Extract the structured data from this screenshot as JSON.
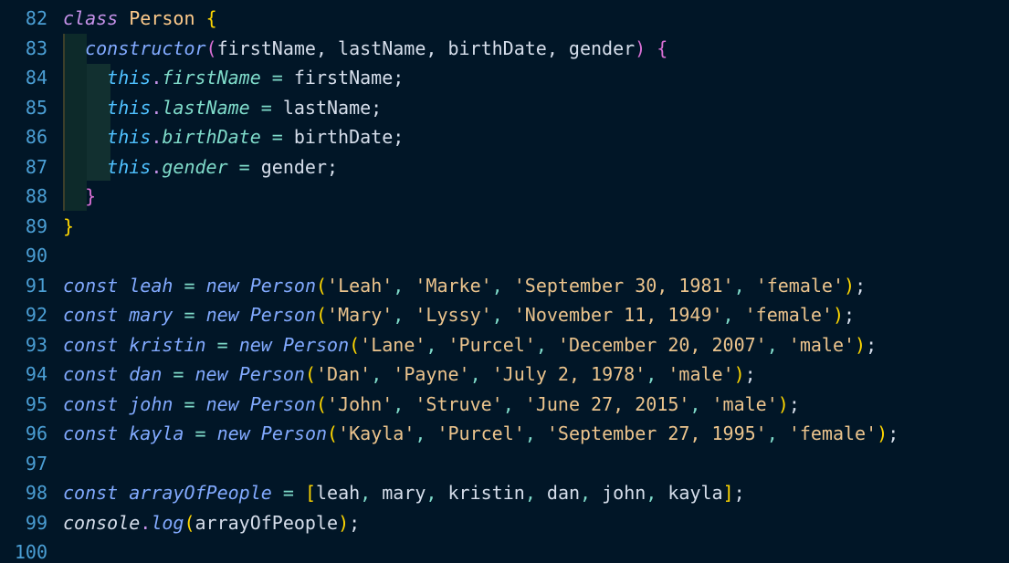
{
  "editor": {
    "lines": [
      {
        "num": "82",
        "tokens": [
          {
            "t": "class",
            "c": "#c792ea",
            "i": true
          },
          {
            "t": " ",
            "c": "#d6deeb"
          },
          {
            "t": "Person",
            "c": "#ffcb8b"
          },
          {
            "t": " ",
            "c": "#d6deeb"
          },
          {
            "t": "{",
            "c": "#ffd700"
          }
        ]
      },
      {
        "num": "83",
        "tokens": [
          {
            "t": "  ",
            "c": "#d6deeb"
          },
          {
            "t": "constructor",
            "c": "#82aaff",
            "i": true
          },
          {
            "t": "(",
            "c": "#da70d6"
          },
          {
            "t": "firstName, lastName, birthDate, gender",
            "c": "#d6deeb"
          },
          {
            "t": ")",
            "c": "#da70d6"
          },
          {
            "t": " ",
            "c": "#d6deeb"
          },
          {
            "t": "{",
            "c": "#da70d6"
          }
        ]
      },
      {
        "num": "84",
        "tokens": [
          {
            "t": "    ",
            "c": "#d6deeb"
          },
          {
            "t": "this",
            "c": "#4fc1ff",
            "i": true
          },
          {
            "t": ".",
            "c": "#c792ea"
          },
          {
            "t": "firstName",
            "c": "#7fdbca",
            "i": true
          },
          {
            "t": " = ",
            "c": "#7fdbca"
          },
          {
            "t": "firstName;",
            "c": "#d6deeb"
          }
        ]
      },
      {
        "num": "85",
        "tokens": [
          {
            "t": "    ",
            "c": "#d6deeb"
          },
          {
            "t": "this",
            "c": "#4fc1ff",
            "i": true
          },
          {
            "t": ".",
            "c": "#c792ea"
          },
          {
            "t": "lastName",
            "c": "#7fdbca",
            "i": true
          },
          {
            "t": " = ",
            "c": "#7fdbca"
          },
          {
            "t": "lastName;",
            "c": "#d6deeb"
          }
        ]
      },
      {
        "num": "86",
        "tokens": [
          {
            "t": "    ",
            "c": "#d6deeb"
          },
          {
            "t": "this",
            "c": "#4fc1ff",
            "i": true
          },
          {
            "t": ".",
            "c": "#c792ea"
          },
          {
            "t": "birthDate",
            "c": "#7fdbca",
            "i": true
          },
          {
            "t": " = ",
            "c": "#7fdbca"
          },
          {
            "t": "birthDate;",
            "c": "#d6deeb"
          }
        ]
      },
      {
        "num": "87",
        "tokens": [
          {
            "t": "    ",
            "c": "#d6deeb"
          },
          {
            "t": "this",
            "c": "#4fc1ff",
            "i": true
          },
          {
            "t": ".",
            "c": "#c792ea"
          },
          {
            "t": "gender",
            "c": "#7fdbca",
            "i": true
          },
          {
            "t": " = ",
            "c": "#7fdbca"
          },
          {
            "t": "gender;",
            "c": "#d6deeb"
          }
        ]
      },
      {
        "num": "88",
        "tokens": [
          {
            "t": "  ",
            "c": "#d6deeb"
          },
          {
            "t": "}",
            "c": "#da70d6"
          }
        ]
      },
      {
        "num": "89",
        "tokens": [
          {
            "t": "}",
            "c": "#ffd700"
          }
        ]
      },
      {
        "num": "90",
        "tokens": []
      },
      {
        "num": "91",
        "tokens": [
          {
            "t": "const",
            "c": "#82aaff",
            "i": true
          },
          {
            "t": " ",
            "c": "#d6deeb"
          },
          {
            "t": "leah",
            "c": "#82aaff",
            "i": true
          },
          {
            "t": " = ",
            "c": "#7fdbca"
          },
          {
            "t": "new",
            "c": "#82aaff",
            "i": true
          },
          {
            "t": " ",
            "c": "#d6deeb"
          },
          {
            "t": "Person",
            "c": "#82aaff",
            "i": true
          },
          {
            "t": "(",
            "c": "#ffd700"
          },
          {
            "t": "'Leah'",
            "c": "#ecc48d"
          },
          {
            "t": ", ",
            "c": "#7fdbca"
          },
          {
            "t": "'Marke'",
            "c": "#ecc48d"
          },
          {
            "t": ", ",
            "c": "#7fdbca"
          },
          {
            "t": "'September 30, 1981'",
            "c": "#ecc48d"
          },
          {
            "t": ", ",
            "c": "#7fdbca"
          },
          {
            "t": "'female'",
            "c": "#ecc48d"
          },
          {
            "t": ")",
            "c": "#ffd700"
          },
          {
            "t": ";",
            "c": "#d6deeb"
          }
        ]
      },
      {
        "num": "92",
        "tokens": [
          {
            "t": "const",
            "c": "#82aaff",
            "i": true
          },
          {
            "t": " ",
            "c": "#d6deeb"
          },
          {
            "t": "mary",
            "c": "#82aaff",
            "i": true
          },
          {
            "t": " = ",
            "c": "#7fdbca"
          },
          {
            "t": "new",
            "c": "#82aaff",
            "i": true
          },
          {
            "t": " ",
            "c": "#d6deeb"
          },
          {
            "t": "Person",
            "c": "#82aaff",
            "i": true
          },
          {
            "t": "(",
            "c": "#ffd700"
          },
          {
            "t": "'Mary'",
            "c": "#ecc48d"
          },
          {
            "t": ", ",
            "c": "#7fdbca"
          },
          {
            "t": "'Lyssy'",
            "c": "#ecc48d"
          },
          {
            "t": ", ",
            "c": "#7fdbca"
          },
          {
            "t": "'November 11, 1949'",
            "c": "#ecc48d"
          },
          {
            "t": ", ",
            "c": "#7fdbca"
          },
          {
            "t": "'female'",
            "c": "#ecc48d"
          },
          {
            "t": ")",
            "c": "#ffd700"
          },
          {
            "t": ";",
            "c": "#d6deeb"
          }
        ]
      },
      {
        "num": "93",
        "tokens": [
          {
            "t": "const",
            "c": "#82aaff",
            "i": true
          },
          {
            "t": " ",
            "c": "#d6deeb"
          },
          {
            "t": "kristin",
            "c": "#82aaff",
            "i": true
          },
          {
            "t": " = ",
            "c": "#7fdbca"
          },
          {
            "t": "new",
            "c": "#82aaff",
            "i": true
          },
          {
            "t": " ",
            "c": "#d6deeb"
          },
          {
            "t": "Person",
            "c": "#82aaff",
            "i": true
          },
          {
            "t": "(",
            "c": "#ffd700"
          },
          {
            "t": "'Lane'",
            "c": "#ecc48d"
          },
          {
            "t": ", ",
            "c": "#7fdbca"
          },
          {
            "t": "'Purcel'",
            "c": "#ecc48d"
          },
          {
            "t": ", ",
            "c": "#7fdbca"
          },
          {
            "t": "'December 20, 2007'",
            "c": "#ecc48d"
          },
          {
            "t": ", ",
            "c": "#7fdbca"
          },
          {
            "t": "'male'",
            "c": "#ecc48d"
          },
          {
            "t": ")",
            "c": "#ffd700"
          },
          {
            "t": ";",
            "c": "#d6deeb"
          }
        ]
      },
      {
        "num": "94",
        "tokens": [
          {
            "t": "const",
            "c": "#82aaff",
            "i": true
          },
          {
            "t": " ",
            "c": "#d6deeb"
          },
          {
            "t": "dan",
            "c": "#82aaff",
            "i": true
          },
          {
            "t": " = ",
            "c": "#7fdbca"
          },
          {
            "t": "new",
            "c": "#82aaff",
            "i": true
          },
          {
            "t": " ",
            "c": "#d6deeb"
          },
          {
            "t": "Person",
            "c": "#82aaff",
            "i": true
          },
          {
            "t": "(",
            "c": "#ffd700"
          },
          {
            "t": "'Dan'",
            "c": "#ecc48d"
          },
          {
            "t": ", ",
            "c": "#7fdbca"
          },
          {
            "t": "'Payne'",
            "c": "#ecc48d"
          },
          {
            "t": ", ",
            "c": "#7fdbca"
          },
          {
            "t": "'July 2, 1978'",
            "c": "#ecc48d"
          },
          {
            "t": ", ",
            "c": "#7fdbca"
          },
          {
            "t": "'male'",
            "c": "#ecc48d"
          },
          {
            "t": ")",
            "c": "#ffd700"
          },
          {
            "t": ";",
            "c": "#d6deeb"
          }
        ]
      },
      {
        "num": "95",
        "tokens": [
          {
            "t": "const",
            "c": "#82aaff",
            "i": true
          },
          {
            "t": " ",
            "c": "#d6deeb"
          },
          {
            "t": "john",
            "c": "#82aaff",
            "i": true
          },
          {
            "t": " = ",
            "c": "#7fdbca"
          },
          {
            "t": "new",
            "c": "#82aaff",
            "i": true
          },
          {
            "t": " ",
            "c": "#d6deeb"
          },
          {
            "t": "Person",
            "c": "#82aaff",
            "i": true
          },
          {
            "t": "(",
            "c": "#ffd700"
          },
          {
            "t": "'John'",
            "c": "#ecc48d"
          },
          {
            "t": ", ",
            "c": "#7fdbca"
          },
          {
            "t": "'Struve'",
            "c": "#ecc48d"
          },
          {
            "t": ", ",
            "c": "#7fdbca"
          },
          {
            "t": "'June 27, 2015'",
            "c": "#ecc48d"
          },
          {
            "t": ", ",
            "c": "#7fdbca"
          },
          {
            "t": "'male'",
            "c": "#ecc48d"
          },
          {
            "t": ")",
            "c": "#ffd700"
          },
          {
            "t": ";",
            "c": "#d6deeb"
          }
        ]
      },
      {
        "num": "96",
        "tokens": [
          {
            "t": "const",
            "c": "#82aaff",
            "i": true
          },
          {
            "t": " ",
            "c": "#d6deeb"
          },
          {
            "t": "kayla",
            "c": "#82aaff",
            "i": true
          },
          {
            "t": " = ",
            "c": "#7fdbca"
          },
          {
            "t": "new",
            "c": "#82aaff",
            "i": true
          },
          {
            "t": " ",
            "c": "#d6deeb"
          },
          {
            "t": "Person",
            "c": "#82aaff",
            "i": true
          },
          {
            "t": "(",
            "c": "#ffd700"
          },
          {
            "t": "'Kayla'",
            "c": "#ecc48d"
          },
          {
            "t": ", ",
            "c": "#7fdbca"
          },
          {
            "t": "'Purcel'",
            "c": "#ecc48d"
          },
          {
            "t": ", ",
            "c": "#7fdbca"
          },
          {
            "t": "'September 27, 1995'",
            "c": "#ecc48d"
          },
          {
            "t": ", ",
            "c": "#7fdbca"
          },
          {
            "t": "'female'",
            "c": "#ecc48d"
          },
          {
            "t": ")",
            "c": "#ffd700"
          },
          {
            "t": ";",
            "c": "#d6deeb"
          }
        ]
      },
      {
        "num": "97",
        "tokens": []
      },
      {
        "num": "98",
        "tokens": [
          {
            "t": "const",
            "c": "#82aaff",
            "i": true
          },
          {
            "t": " ",
            "c": "#d6deeb"
          },
          {
            "t": "arrayOfPeople",
            "c": "#82aaff",
            "i": true
          },
          {
            "t": " = ",
            "c": "#7fdbca"
          },
          {
            "t": "[",
            "c": "#ffd700"
          },
          {
            "t": "leah",
            "c": "#d6deeb"
          },
          {
            "t": ", ",
            "c": "#7fdbca"
          },
          {
            "t": "mary",
            "c": "#d6deeb"
          },
          {
            "t": ", ",
            "c": "#7fdbca"
          },
          {
            "t": "kristin",
            "c": "#d6deeb"
          },
          {
            "t": ", ",
            "c": "#7fdbca"
          },
          {
            "t": "dan",
            "c": "#d6deeb"
          },
          {
            "t": ", ",
            "c": "#7fdbca"
          },
          {
            "t": "john",
            "c": "#d6deeb"
          },
          {
            "t": ", ",
            "c": "#7fdbca"
          },
          {
            "t": "kayla",
            "c": "#d6deeb"
          },
          {
            "t": "]",
            "c": "#ffd700"
          },
          {
            "t": ";",
            "c": "#d6deeb"
          }
        ]
      },
      {
        "num": "99",
        "tokens": [
          {
            "t": "console",
            "c": "#d6deeb",
            "i": true
          },
          {
            "t": ".",
            "c": "#c792ea"
          },
          {
            "t": "log",
            "c": "#82aaff",
            "i": true
          },
          {
            "t": "(",
            "c": "#ffd700"
          },
          {
            "t": "arrayOfPeople",
            "c": "#d6deeb"
          },
          {
            "t": ")",
            "c": "#ffd700"
          },
          {
            "t": ";",
            "c": "#d6deeb"
          }
        ]
      },
      {
        "num": "100",
        "tokens": []
      }
    ]
  }
}
